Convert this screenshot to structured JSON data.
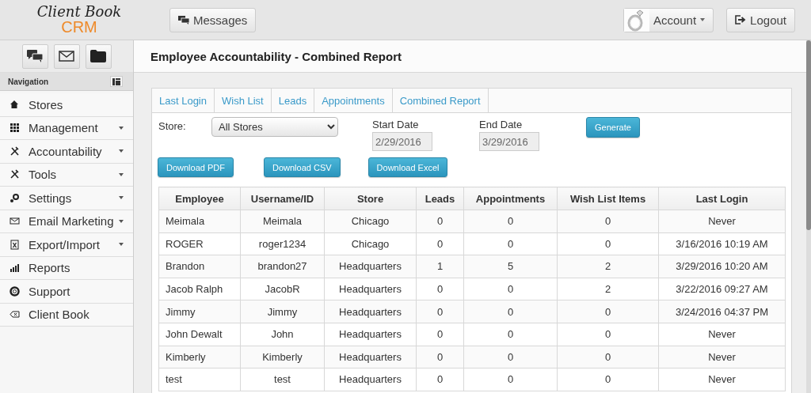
{
  "header": {
    "logo_line_1": "Client Book",
    "logo_line_2": "CRM",
    "messages_button": "Messages",
    "account_button": "Account",
    "logout_button": "Logout"
  },
  "page_title": "Employee Accountability - Combined Report",
  "navigation": {
    "title": "Navigation",
    "items": [
      {
        "label": "Stores",
        "dropdown": false
      },
      {
        "label": "Management",
        "dropdown": true
      },
      {
        "label": "Accountability",
        "dropdown": true
      },
      {
        "label": "Tools",
        "dropdown": true
      },
      {
        "label": "Settings",
        "dropdown": true
      },
      {
        "label": "Email Marketing",
        "dropdown": true
      },
      {
        "label": "Export/Import",
        "dropdown": true
      },
      {
        "label": "Reports",
        "dropdown": false
      },
      {
        "label": "Support",
        "dropdown": false
      },
      {
        "label": "Client Book",
        "dropdown": false
      }
    ]
  },
  "tabs": [
    {
      "label": "Last Login",
      "selected": false
    },
    {
      "label": "Wish List",
      "selected": false
    },
    {
      "label": "Leads",
      "selected": false
    },
    {
      "label": "Appointments",
      "selected": false
    },
    {
      "label": "Combined Report",
      "selected": false
    }
  ],
  "filters": {
    "store_label": "Store:",
    "store_value": "All Stores",
    "start_label": "Start Date",
    "start_value": "2/29/2016",
    "start_disabled": true,
    "end_label": "End Date",
    "end_value": "3/29/2016",
    "end_disabled": true,
    "generate_button": "Generate"
  },
  "download_buttons": [
    "Download PDF",
    "Download CSV",
    "Download Excel"
  ],
  "table": {
    "columns": [
      "Employee",
      "Username/ID",
      "Store",
      "Leads",
      "Appointments",
      "Wish List Items",
      "Last Login"
    ],
    "rows": [
      [
        "Meimala",
        "Meimala",
        "Chicago",
        "0",
        "0",
        "0",
        "Never"
      ],
      [
        "ROGER",
        "roger1234",
        "Chicago",
        "0",
        "0",
        "0",
        "3/16/2016 10:19 AM"
      ],
      [
        "Brandon",
        "brandon27",
        "Headquarters",
        "1",
        "5",
        "2",
        "3/29/2016 10:20 AM"
      ],
      [
        "Jacob Ralph",
        "JacobR",
        "Headquarters",
        "0",
        "0",
        "2",
        "3/22/2016 09:27 AM"
      ],
      [
        "Jimmy",
        "Jimmy",
        "Headquarters",
        "0",
        "0",
        "0",
        "3/24/2016 04:37 PM"
      ],
      [
        "John Dewalt",
        "John",
        "Headquarters",
        "0",
        "0",
        "0",
        "Never"
      ],
      [
        "Kimberly",
        "Kimberly",
        "Headquarters",
        "0",
        "0",
        "0",
        "Never"
      ],
      [
        "test",
        "test",
        "Headquarters",
        "0",
        "0",
        "0",
        "Never"
      ]
    ]
  }
}
